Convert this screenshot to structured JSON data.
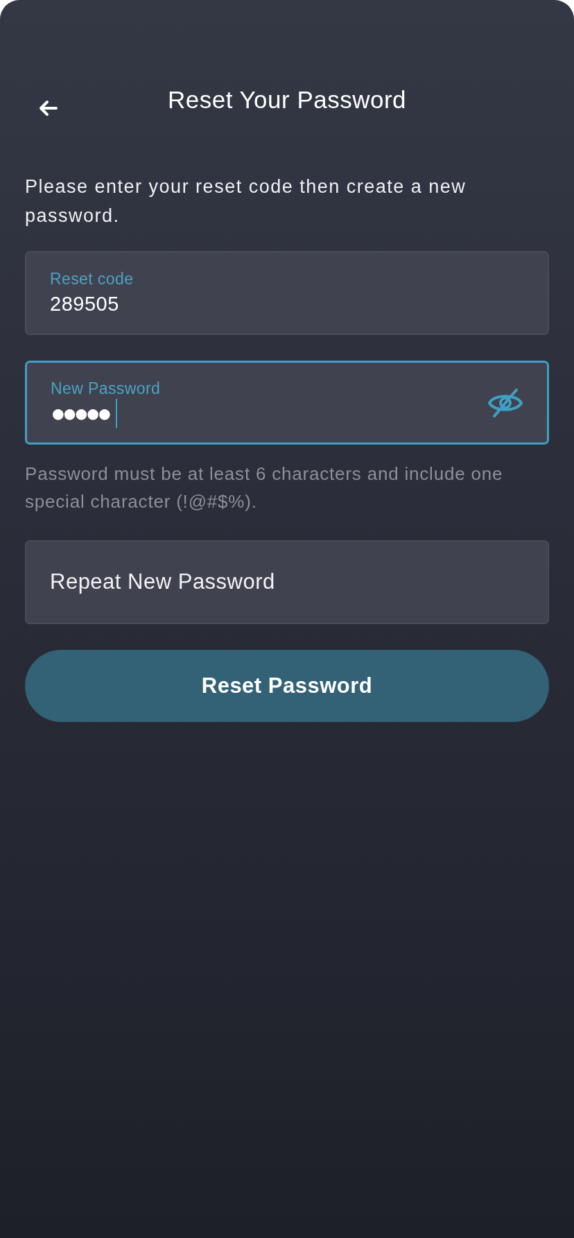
{
  "header": {
    "title": "Reset Your Password"
  },
  "intro": "Please enter your reset code then create a new password.",
  "fields": [
    {
      "kind": "filled",
      "label": "Reset code",
      "value": "289505",
      "focused": false
    },
    {
      "kind": "password",
      "label": "New Password",
      "value": "●●●●●",
      "focused": true,
      "show_password": false
    },
    {
      "kind": "empty",
      "placeholder": "Repeat New Password",
      "focused": false
    }
  ],
  "hint": "Password must be at least 6 characters and include one special character (!@#$%).",
  "submit": {
    "label": "Reset Password"
  }
}
